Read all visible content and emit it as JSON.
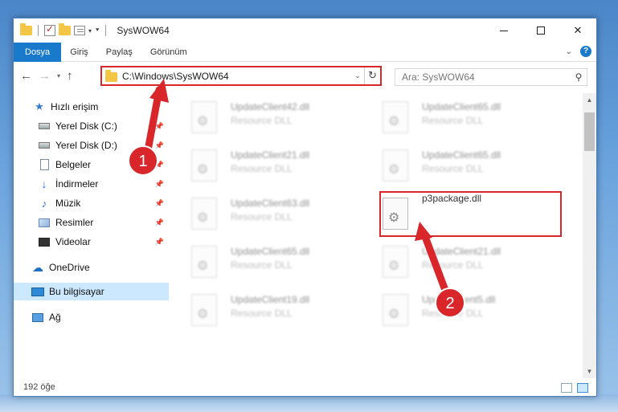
{
  "window": {
    "title": "SysWOW64"
  },
  "ribbon": {
    "tabs": [
      "Dosya",
      "Giriş",
      "Paylaş",
      "Görünüm"
    ],
    "active_tab": "Dosya",
    "help": "?"
  },
  "addressbar": {
    "path": "C:\\Windows\\SysWOW64",
    "search_placeholder": "Ara: SysWOW64"
  },
  "sidebar": {
    "items": [
      {
        "label": "Hızlı erişim",
        "icon": "star-icon"
      },
      {
        "label": "Yerel Disk (C:)",
        "icon": "drive-icon",
        "pinned": true
      },
      {
        "label": "Yerel Disk (D:)",
        "icon": "drive-icon",
        "pinned": true
      },
      {
        "label": "Belgeler",
        "icon": "documents-icon",
        "pinned": true
      },
      {
        "label": "İndirmeler",
        "icon": "downloads-icon",
        "pinned": true
      },
      {
        "label": "Müzik",
        "icon": "music-icon",
        "pinned": true
      },
      {
        "label": "Resimler",
        "icon": "pictures-icon",
        "pinned": true
      },
      {
        "label": "Videolar",
        "icon": "videos-icon",
        "pinned": true
      },
      {
        "label": "OneDrive",
        "icon": "onedrive-icon"
      },
      {
        "label": "Bu bilgisayar",
        "icon": "this-pc-icon",
        "selected": true
      },
      {
        "label": "Ağ",
        "icon": "network-icon"
      }
    ]
  },
  "files": [
    {
      "name": "UpdateClient42.dll",
      "type": "Resource DLL",
      "blurred": true
    },
    {
      "name": "UpdateClient65.dll",
      "type": "Resource DLL",
      "blurred": true
    },
    {
      "name": "UpdateClient21.dll",
      "type": "Resource DLL",
      "blurred": true
    },
    {
      "name": "UpdateClient65.dll",
      "type": "Resource DLL",
      "blurred": true
    },
    {
      "name": "UpdateClient63.dll",
      "type": "Resource DLL",
      "blurred": true
    },
    {
      "name": "p3package.dll",
      "type": "",
      "blurred": false,
      "highlighted": true
    },
    {
      "name": "UpdateClient65.dll",
      "type": "Resource DLL",
      "blurred": true
    },
    {
      "name": "UpdateClient21.dll",
      "type": "Resource DLL",
      "blurred": true
    },
    {
      "name": "UpdateClient19.dll",
      "type": "Resource DLL",
      "blurred": true
    },
    {
      "name": "UpdateClient5.dll",
      "type": "Resource DLL",
      "blurred": true
    }
  ],
  "status": {
    "count": "192 öğe"
  },
  "annotations": {
    "step1": "1",
    "step2": "2",
    "color": "#d8262b"
  }
}
